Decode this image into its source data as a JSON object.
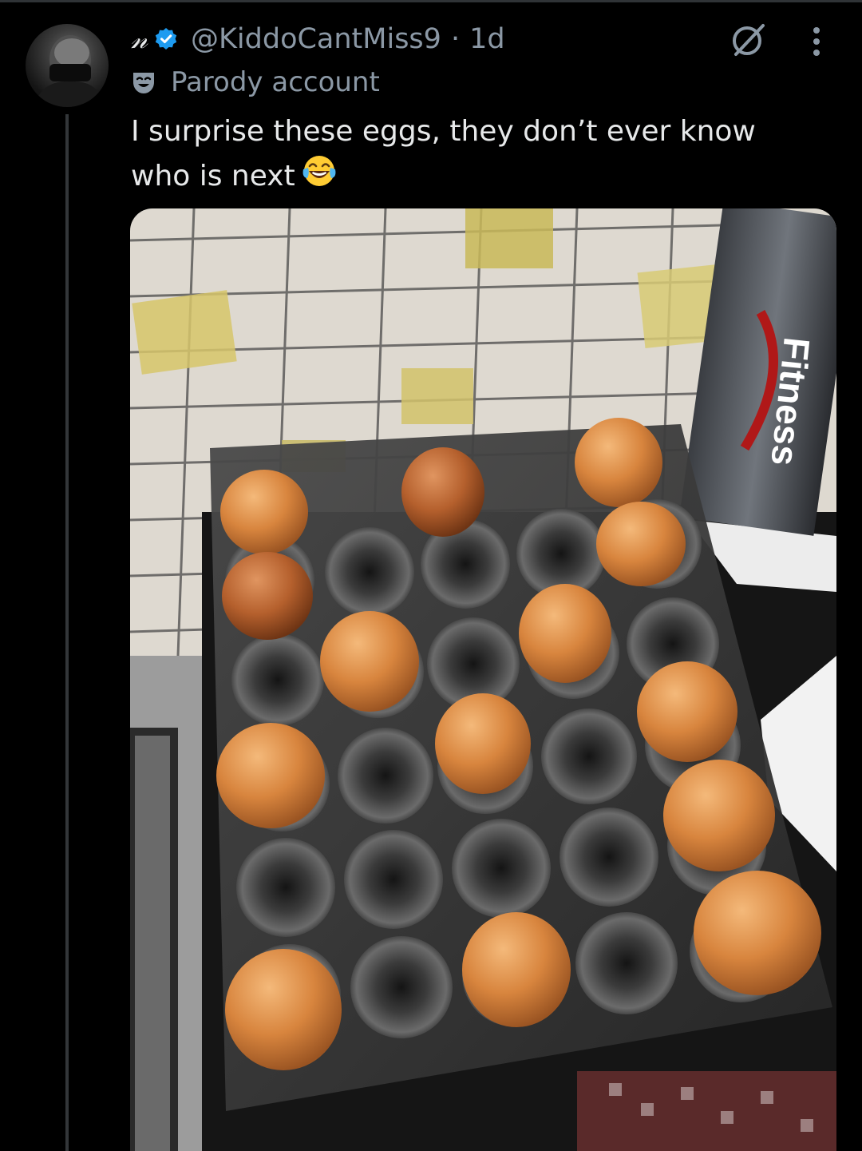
{
  "post": {
    "display_name": "𝓃",
    "handle": "@KiddoCantMiss9",
    "separator": "·",
    "time": "1d",
    "label": "Parody account",
    "text_line1": "I surprise these eggs, they don’t ever know",
    "text_line2": "who is next"
  },
  "icons": {
    "verified": "verified-badge-icon",
    "label": "drama-mask-icon",
    "grok": "grok-icon",
    "more": "more-options-icon",
    "emoji": "laughing-tears-emoji"
  },
  "media": {
    "bottle_text": "Fitness"
  },
  "colors": {
    "background": "#000000",
    "text": "#e7e9ea",
    "secondary": "#8b98a5",
    "verified": "#1d9bf0"
  }
}
